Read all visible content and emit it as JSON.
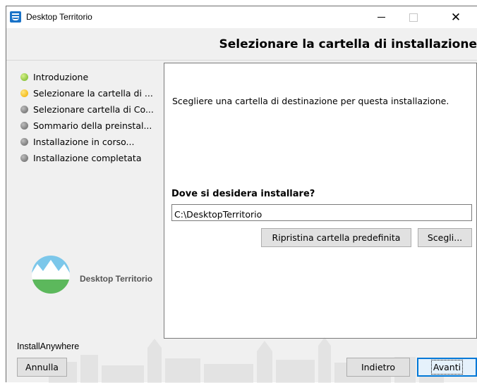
{
  "window": {
    "title": "Desktop Territorio",
    "minimize_glyph": "–",
    "close_glyph": "✕"
  },
  "header": {
    "title": "Selezionare la cartella di installazione"
  },
  "steps": [
    {
      "label": "Introduzione",
      "status": "completed",
      "color": "#8dc63f"
    },
    {
      "label": "Selezionare la cartella di ...",
      "status": "current",
      "color": "#f5bd1f"
    },
    {
      "label": "Selezionare cartella di Co...",
      "status": "pending",
      "color": "#7d7d7d"
    },
    {
      "label": "Sommario della preinstal...",
      "status": "pending",
      "color": "#7d7d7d"
    },
    {
      "label": "Installazione in corso...",
      "status": "pending",
      "color": "#7d7d7d"
    },
    {
      "label": "Installazione completata",
      "status": "pending",
      "color": "#7d7d7d"
    }
  ],
  "logo": {
    "text": "Desktop Territorio"
  },
  "panel": {
    "instruction": "Scegliere una cartella di destinazione per questa installazione.",
    "question": "Dove si desidera installare?",
    "path_value": "C:\\DesktopTerritorio",
    "restore_label": "Ripristina cartella predefinita",
    "choose_label": "Scegli..."
  },
  "footer": {
    "vendor": "InstallAnywhere",
    "cancel_label": "Annulla",
    "back_label": "Indietro",
    "next_label": "Avanti"
  },
  "colors": {
    "accent": "#0078d7",
    "current_step": "#f5bd1f",
    "done_step": "#8dc63f",
    "pending_step": "#7d7d7d"
  }
}
